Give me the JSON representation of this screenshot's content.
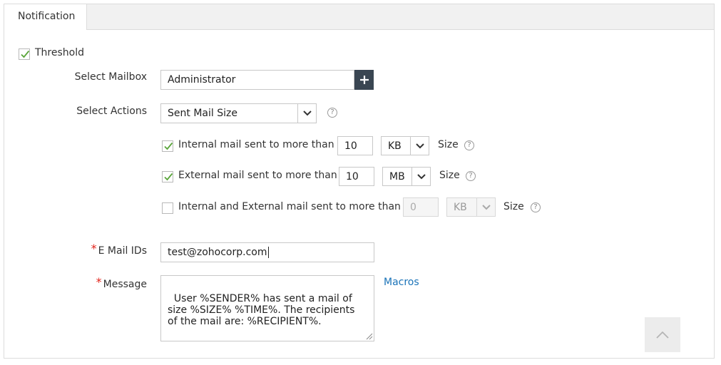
{
  "tabs": [
    {
      "label": "Notification"
    }
  ],
  "threshold": {
    "label": "Threshold",
    "checked": true
  },
  "mailbox": {
    "label": "Select Mailbox",
    "value": "Administrator",
    "add_icon": "plus-icon"
  },
  "actions": {
    "label": "Select Actions",
    "value": "Sent Mail Size",
    "help_icon": "help-icon"
  },
  "rules": [
    {
      "checked": true,
      "label": "Internal mail sent to more than",
      "value": "10",
      "unit": "KB",
      "size_label": "Size",
      "disabled": false
    },
    {
      "checked": true,
      "label": "External mail sent to more than",
      "value": "10",
      "unit": "MB",
      "size_label": "Size",
      "disabled": false
    },
    {
      "checked": false,
      "label": "Internal and External mail sent to more than",
      "value": "0",
      "unit": "KB",
      "size_label": "Size",
      "disabled": true
    }
  ],
  "email": {
    "required_mark": "*",
    "label": "E Mail IDs",
    "value": "test@zohocorp.com"
  },
  "message": {
    "required_mark": "*",
    "label": "Message",
    "value": "User %SENDER% has sent a mail of\nsize %SIZE% %TIME%. The recipients\nof the mail are: %RECIPIENT%."
  },
  "macros": {
    "label": "Macros"
  },
  "colors": {
    "accent_link": "#1a73b8",
    "check": "#5aa53a",
    "plus_button": "#3a4652",
    "required": "#e2231a"
  },
  "scroll_top": {
    "icon": "chevron-up-icon"
  }
}
